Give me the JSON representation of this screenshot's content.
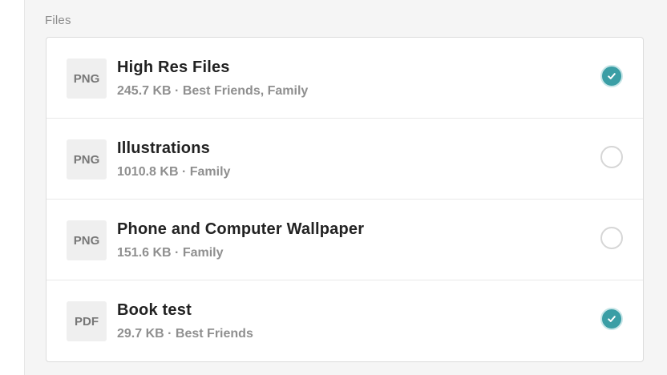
{
  "section": {
    "label": "Files"
  },
  "files": [
    {
      "type": "PNG",
      "name": "High Res Files",
      "size": "245.7 KB",
      "groups": "Best Friends, Family",
      "selected": true
    },
    {
      "type": "PNG",
      "name": "Illustrations",
      "size": "1010.8 KB",
      "groups": "Family",
      "selected": false
    },
    {
      "type": "PNG",
      "name": "Phone and Computer Wallpaper",
      "size": "151.6 KB",
      "groups": "Family",
      "selected": false
    },
    {
      "type": "PDF",
      "name": "Book test",
      "size": "29.7 KB",
      "groups": "Best Friends",
      "selected": true
    }
  ],
  "meta_separator": " · ",
  "colors": {
    "accent": "#3a9ea5",
    "title": "#222222",
    "meta": "#8f8f8f"
  },
  "icons": {
    "selected": "check-icon",
    "unselected": "empty-circle"
  }
}
